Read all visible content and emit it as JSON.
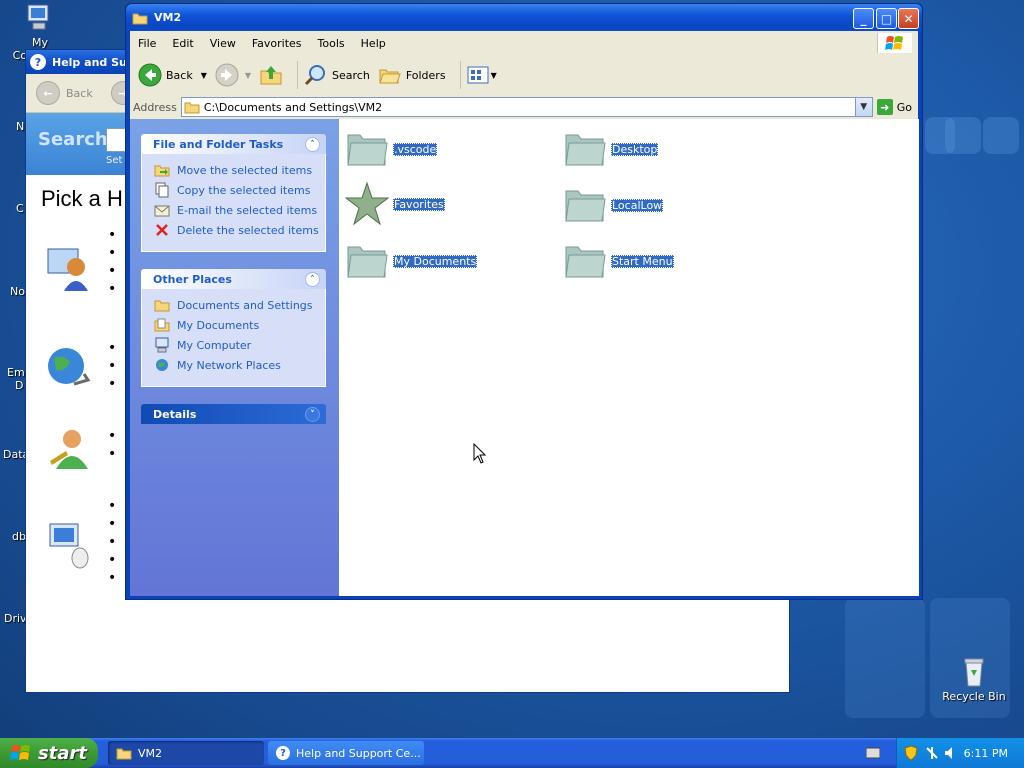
{
  "desktop": {
    "icons": [
      {
        "label": "My Computer",
        "name": "my-computer"
      },
      {
        "label": "Recycle Bin",
        "name": "recycle-bin"
      }
    ],
    "partial_labels": [
      "N",
      "C",
      "No",
      "Em",
      "D",
      "Data",
      "db",
      "Driv"
    ]
  },
  "help_window": {
    "title": "Help and Support",
    "back_label": "Back",
    "search_label": "Search",
    "set_search_label": "Set s",
    "heading": "Pick a H"
  },
  "explorer": {
    "title": "VM2",
    "menu": [
      "File",
      "Edit",
      "View",
      "Favorites",
      "Tools",
      "Help"
    ],
    "toolbar": {
      "back": "Back",
      "search": "Search",
      "folders": "Folders"
    },
    "address": {
      "label": "Address",
      "value": "C:\\Documents and Settings\\VM2",
      "go": "Go"
    },
    "tasks": {
      "title": "File and Folder Tasks",
      "items": [
        {
          "label": "Move the selected items",
          "icon": "move-icon"
        },
        {
          "label": "Copy the selected items",
          "icon": "copy-icon"
        },
        {
          "label": "E-mail the selected items",
          "icon": "email-icon"
        },
        {
          "label": "Delete the selected items",
          "icon": "delete-icon"
        }
      ]
    },
    "places": {
      "title": "Other Places",
      "items": [
        {
          "label": "Documents and Settings",
          "icon": "folder-icon"
        },
        {
          "label": "My Documents",
          "icon": "my-documents-icon"
        },
        {
          "label": "My Computer",
          "icon": "my-computer-icon"
        },
        {
          "label": "My Network Places",
          "icon": "network-places-icon"
        }
      ]
    },
    "details": {
      "title": "Details"
    },
    "files": [
      {
        "label": ".vscode",
        "icon": "folder-icon"
      },
      {
        "label": "Desktop",
        "icon": "folder-icon"
      },
      {
        "label": "Favorites",
        "icon": "star-icon"
      },
      {
        "label": "LocalLow",
        "icon": "folder-icon"
      },
      {
        "label": "My Documents",
        "icon": "folder-icon"
      },
      {
        "label": "Start Menu",
        "icon": "folder-icon"
      }
    ]
  },
  "taskbar": {
    "start": "start",
    "tasks": [
      {
        "label": "VM2",
        "active": true
      },
      {
        "label": "Help and Support Ce...",
        "active": false
      }
    ],
    "clock": "6:11 PM"
  },
  "colors": {
    "selection": "#316ac5",
    "taskpane_link": "#215dc6",
    "titlebar": "#0a46c2"
  }
}
